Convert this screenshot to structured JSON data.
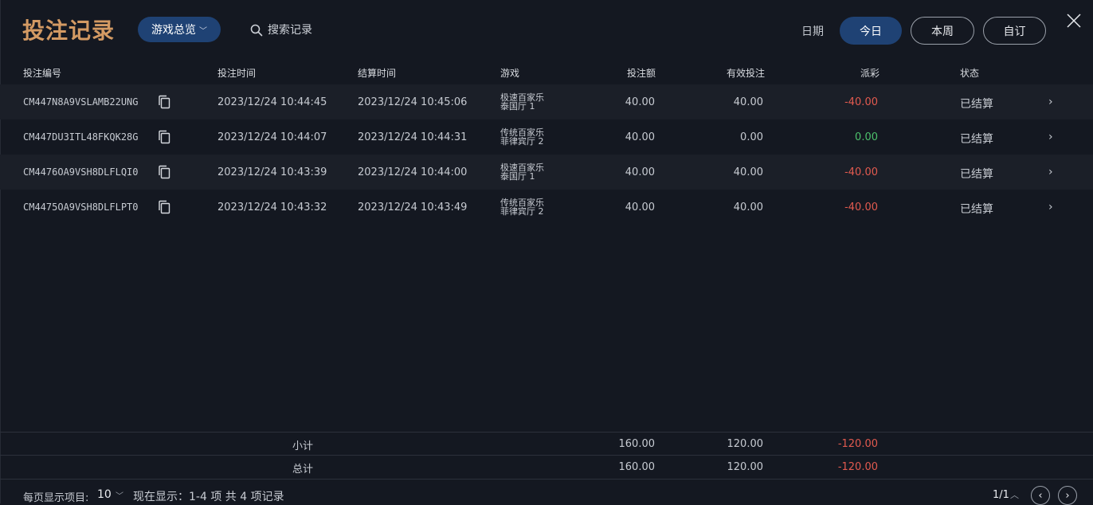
{
  "header": {
    "title": "投注记录",
    "game_filter": "游戏总览",
    "search_placeholder": "搜索记录",
    "date_label": "日期",
    "date_buttons": [
      "今日",
      "本周",
      "自订"
    ]
  },
  "table": {
    "columns": [
      "投注编号",
      "投注时间",
      "结算时间",
      "游戏",
      "投注额",
      "有效投注",
      "派彩",
      "状态"
    ],
    "rows": [
      {
        "bet_id": "CM447N8A9VSLAMB22UNG",
        "bet_time": "2023/12/24 10:44:45",
        "settle_time": "2023/12/24 10:45:06",
        "game_line1": "极速百家乐",
        "game_line2": "泰国厅 1",
        "bet_amount": "40.00",
        "valid_bet": "40.00",
        "payout": "-40.00",
        "status": "已结算"
      },
      {
        "bet_id": "CM447DU3ITL48FKQK28G",
        "bet_time": "2023/12/24 10:44:07",
        "settle_time": "2023/12/24 10:44:31",
        "game_line1": "传统百家乐",
        "game_line2": "菲律宾厅 2",
        "bet_amount": "40.00",
        "valid_bet": "0.00",
        "payout": "0.00",
        "status": "已结算"
      },
      {
        "bet_id": "CM4476OA9VSH8DLFLQI0",
        "bet_time": "2023/12/24 10:43:39",
        "settle_time": "2023/12/24 10:44:00",
        "game_line1": "极速百家乐",
        "game_line2": "泰国厅 1",
        "bet_amount": "40.00",
        "valid_bet": "40.00",
        "payout": "-40.00",
        "status": "已结算"
      },
      {
        "bet_id": "CM4475OA9VSH8DLFLPT0",
        "bet_time": "2023/12/24 10:43:32",
        "settle_time": "2023/12/24 10:43:49",
        "game_line1": "传统百家乐",
        "game_line2": "菲律宾厅 2",
        "bet_amount": "40.00",
        "valid_bet": "40.00",
        "payout": "-40.00",
        "status": "已结算"
      }
    ],
    "subtotal": {
      "label": "小计",
      "bet_amount": "160.00",
      "valid_bet": "120.00",
      "payout": "-120.00"
    },
    "total": {
      "label": "总计",
      "bet_amount": "160.00",
      "valid_bet": "120.00",
      "payout": "-120.00"
    }
  },
  "footer": {
    "per_page_label": "每页显示项目:",
    "per_page_value": "10",
    "showing_text": "现在显示：1-4 项 共 4 项记录",
    "page_indicator": "1/1"
  },
  "colors": {
    "background": "#141821",
    "title": "#d39a63",
    "active_pill": "#1f4274",
    "negative": "#e25a4f",
    "zero": "#4cc06b"
  },
  "icons": {
    "search": "search-icon",
    "close": "close-icon",
    "copy": "copy-icon",
    "row_chevron": "chevron-right-icon",
    "prev": "prev-page-icon",
    "next": "next-page-icon"
  }
}
